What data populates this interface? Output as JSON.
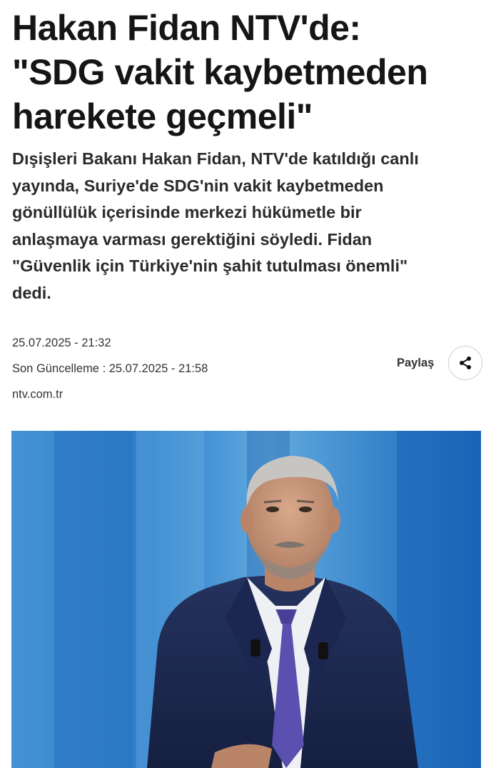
{
  "article": {
    "headline": "Hakan Fidan NTV'de:\n\"SDG vakit kaybetmeden\nharekete geçmeli\"",
    "summary": "Dışişleri Bakanı Hakan Fidan, NTV'de katıldığı canlı\nyayında, Suriye'de SDG'nin vakit kaybetmeden\ngönüllülük içerisinde merkezi hükümetle bir\nanlaşmaya varması gerektiğini söyledi. Fidan\n\"Güvenlik için Türkiye'nin şahit tutulması önemli\"\ndedi.",
    "published": "25.07.2025 - 21:32",
    "updated": "Son Güncelleme : 25.07.2025 - 21:58",
    "source": "ntv.com.tr"
  },
  "share": {
    "label": "Paylaş",
    "icon": "share-icon"
  },
  "colors": {
    "studio_blue": "#2f7fd0",
    "suit_navy": "#1c2a52",
    "tie_purple": "#5b4fb0"
  }
}
